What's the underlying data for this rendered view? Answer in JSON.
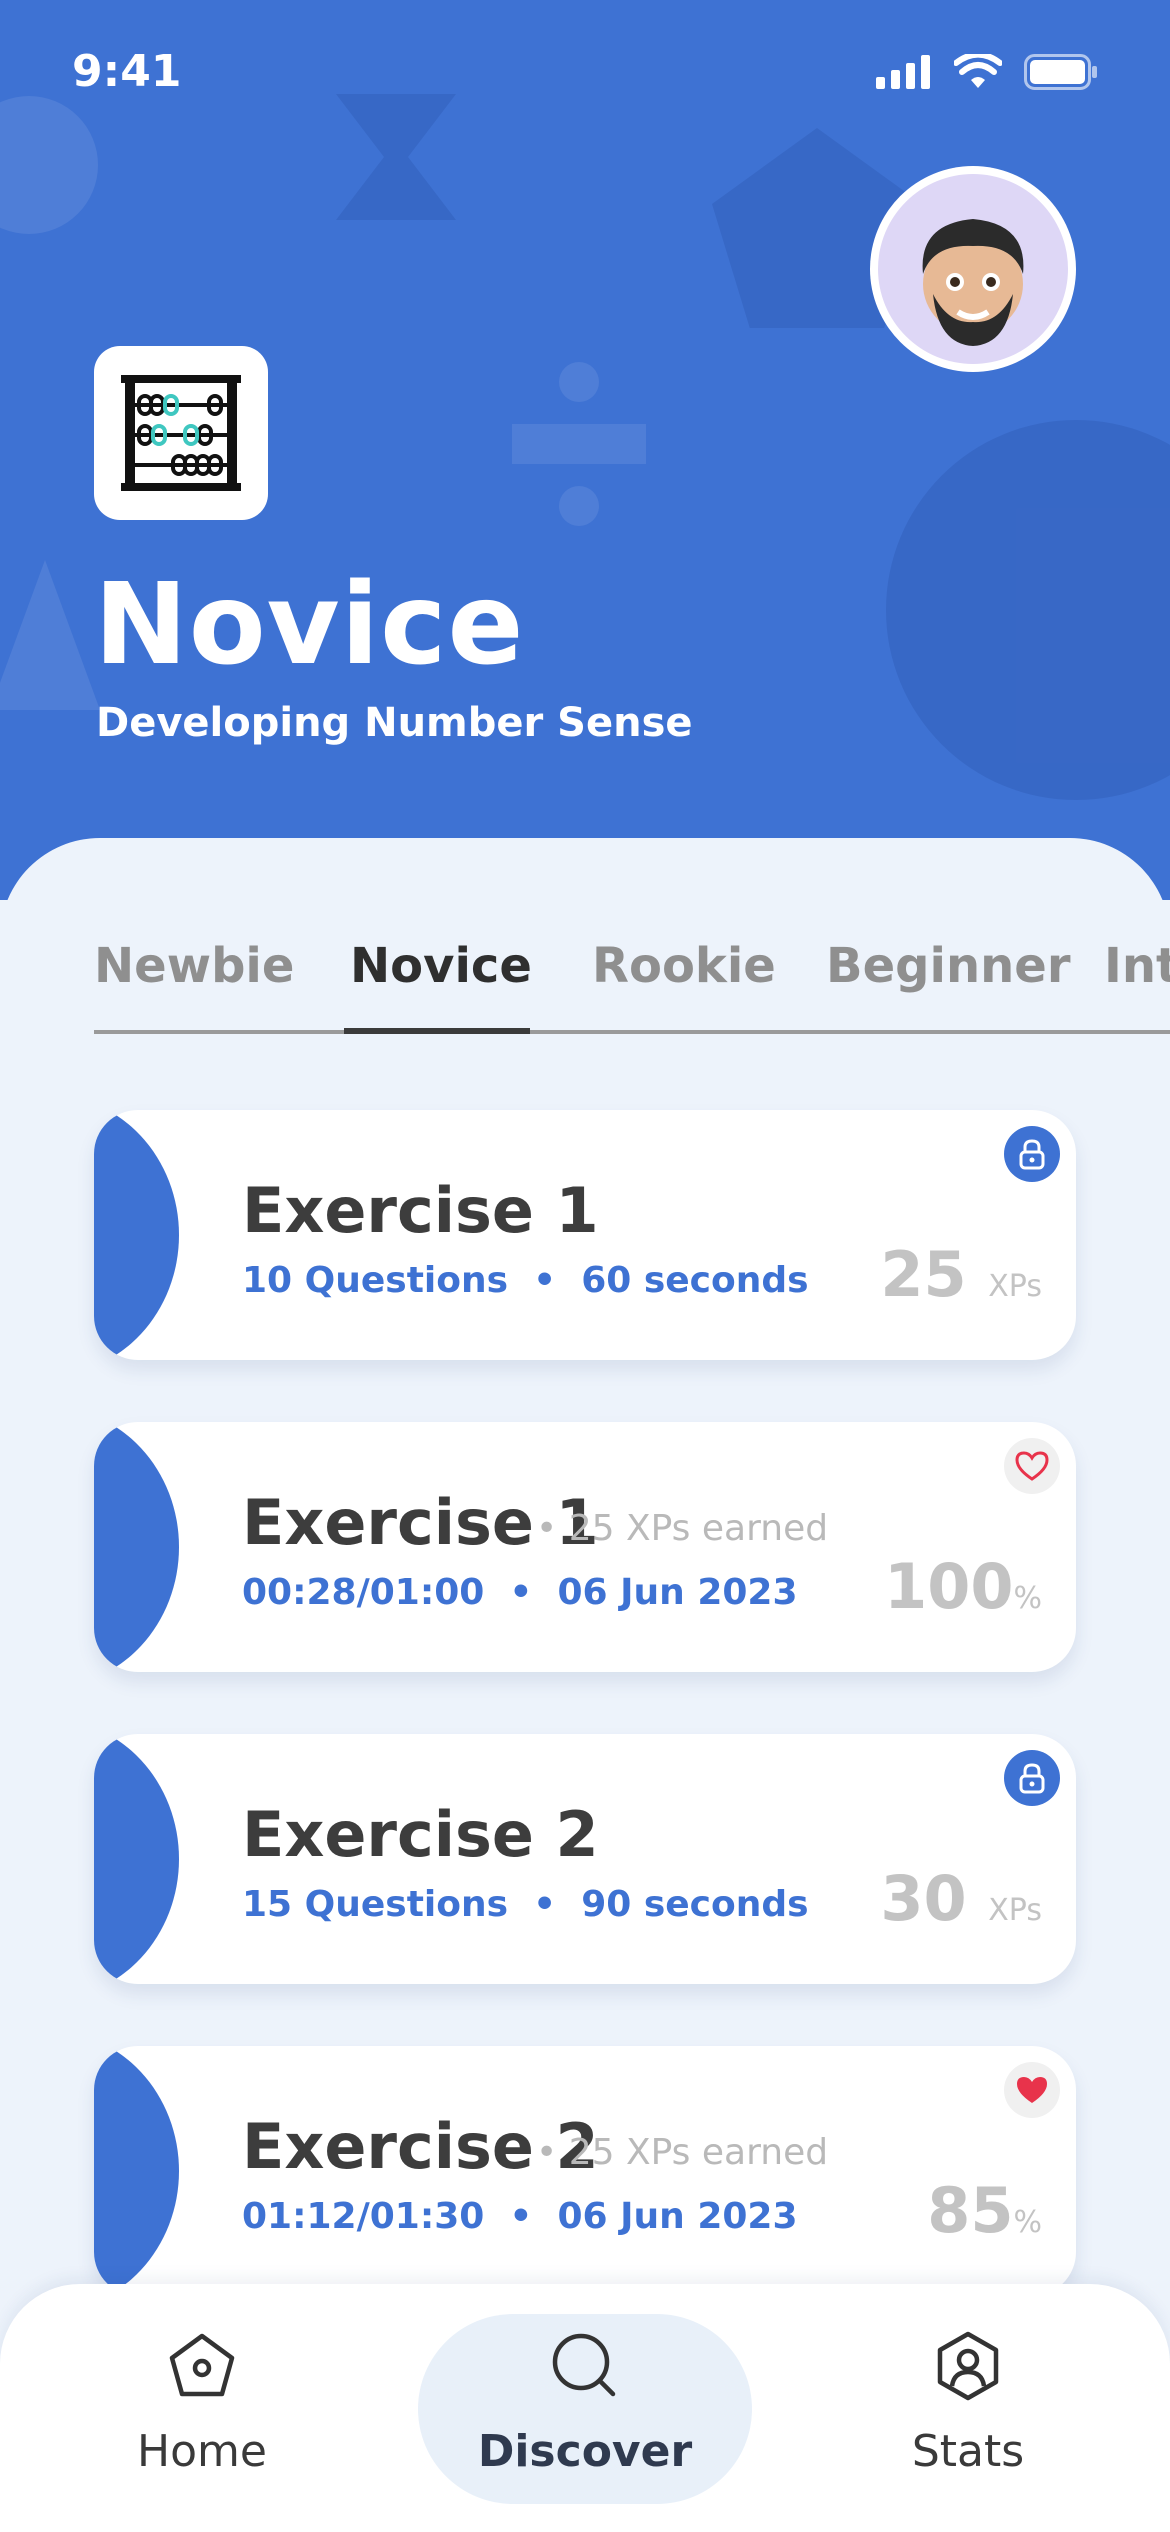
{
  "status_bar": {
    "time": "9:41"
  },
  "colors": {
    "primary": "#3e72d3",
    "background": "#edf3fb",
    "heart_red": "#e8334b"
  },
  "header": {
    "title": "Novice",
    "subtitle": "Developing Number Sense",
    "level_icon": "abacus-icon",
    "avatar": "avatar-icon"
  },
  "tabs": [
    {
      "label": "Newbie",
      "active": false
    },
    {
      "label": "Novice",
      "active": true
    },
    {
      "label": "Rookie",
      "active": false
    },
    {
      "label": "Beginner",
      "active": false
    },
    {
      "label": "Intermediate",
      "active": false
    }
  ],
  "cards": [
    {
      "title": "Exercise 1",
      "meta_left": "10 Questions",
      "meta_right": "60 seconds",
      "value": "25",
      "unit": "XPs",
      "status_icon": "lock-icon"
    },
    {
      "title": "Exercise 1",
      "earned": "25 XPs earned",
      "meta_left": "00:28/01:00",
      "meta_right": "06 Jun 2023",
      "value": "100",
      "unit": "%",
      "status_icon": "heart-outline-icon"
    },
    {
      "title": "Exercise 2",
      "meta_left": "15 Questions",
      "meta_right": "90 seconds",
      "value": "30",
      "unit": "XPs",
      "status_icon": "lock-icon"
    },
    {
      "title": "Exercise 2",
      "earned": "25 XPs earned",
      "meta_left": "01:12/01:30",
      "meta_right": "06 Jun 2023",
      "value": "85",
      "unit": "%",
      "status_icon": "heart-filled-icon"
    }
  ],
  "nav": [
    {
      "label": "Home",
      "icon": "home-icon",
      "active": false
    },
    {
      "label": "Discover",
      "icon": "search-icon",
      "active": true
    },
    {
      "label": "Stats",
      "icon": "profile-icon",
      "active": false
    }
  ]
}
